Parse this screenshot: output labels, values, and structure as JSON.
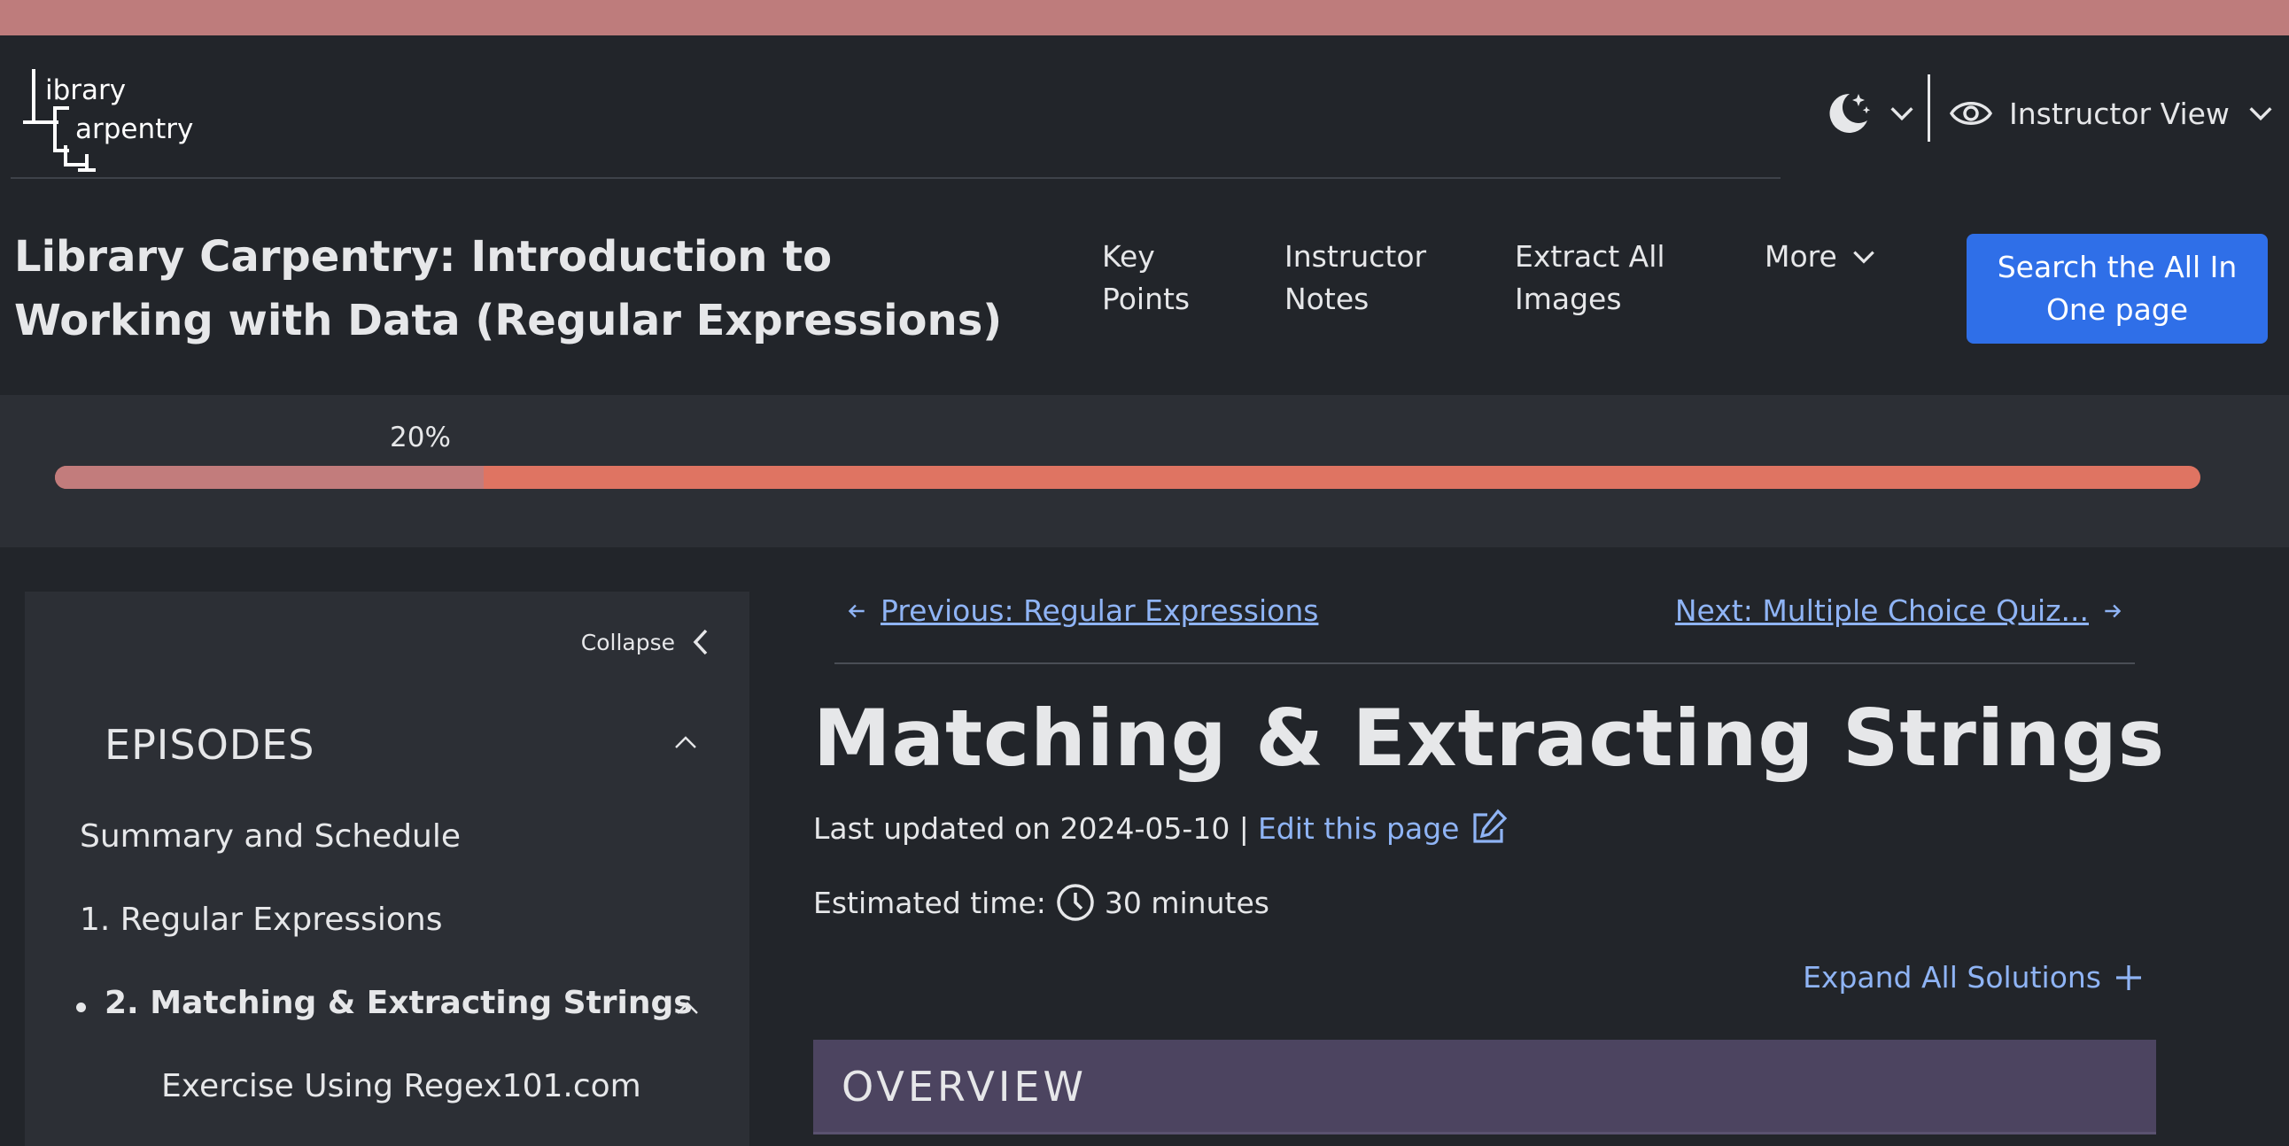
{
  "logo": {
    "line1": "ibrary",
    "line2": "arpentry"
  },
  "header": {
    "instructor_view": "Instructor View",
    "course_title": "Library Carpentry: Introduction to Working with Data (Regular Expressions)",
    "nav": [
      {
        "label_1": "Key",
        "label_2": "Points"
      },
      {
        "label_1": "Instructor",
        "label_2": "Notes"
      },
      {
        "label_1": "Extract All",
        "label_2": "Images"
      }
    ],
    "more": "More",
    "search_1": "Search the All In",
    "search_2": "One page"
  },
  "progress": {
    "label": "20%",
    "value": 0.2
  },
  "sidebar": {
    "collapse": "Collapse",
    "episodes": "EPISODES",
    "items": [
      "Summary and Schedule",
      "1. Regular Expressions",
      "2. Matching & Extracting Strings"
    ],
    "sub_items": [
      "Exercise Using Regex101.com"
    ]
  },
  "pager": {
    "prev": "Previous: Regular Expressions",
    "next": "Next: Multiple Choice Quiz..."
  },
  "main": {
    "title": "Matching & Extracting Strings",
    "last_updated": "Last updated on 2024-05-10 |",
    "edit": "Edit this page",
    "est_label": "Estimated time:",
    "est_value": "30 minutes",
    "expand_all": "Expand All Solutions",
    "overview": "OVERVIEW"
  },
  "colors": {
    "top_strip": "#be7c7c",
    "accent_button": "#2f6fe8",
    "link": "#8fb4f5",
    "progress_track": "#df7462",
    "progress_fill": "#c27c7c",
    "overview_bg": "#4c4460"
  }
}
